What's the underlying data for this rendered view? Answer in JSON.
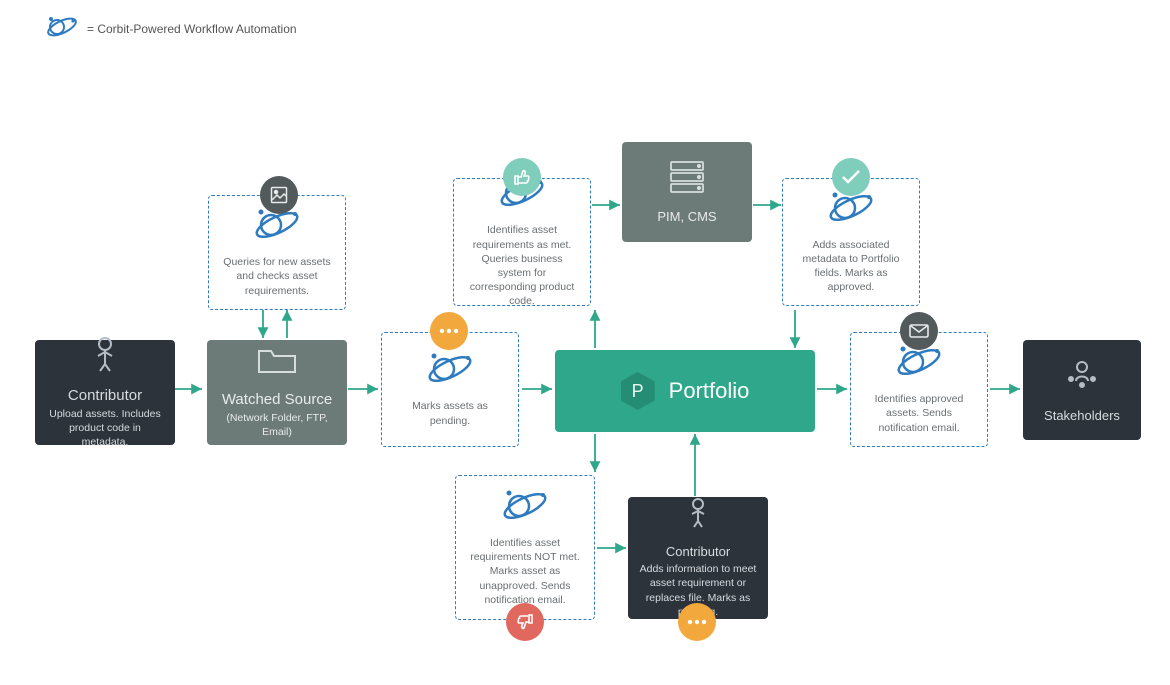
{
  "legend": {
    "text": "= Corbit-Powered Workflow Automation"
  },
  "nodes": {
    "contributor1": {
      "title": "Contributor",
      "sub": "Upload assets. Includes product code in metadata."
    },
    "watchedSource": {
      "title": "Watched Source",
      "sub": "(Network Folder, FTP, Email)"
    },
    "queryAssets": {
      "sub": "Queries for new assets and checks asset requirements."
    },
    "marksPending": {
      "sub": "Marks assets as pending."
    },
    "portfolio": {
      "label": "Portfolio",
      "badge": "P"
    },
    "reqMet": {
      "sub": "Identifies asset requirements as met. Queries business system for corresponding product code."
    },
    "pimCms": {
      "title": "PIM, CMS"
    },
    "addsMetadata": {
      "sub": "Adds associated metadata to Portfolio fields. Marks as approved."
    },
    "reqNotMet": {
      "sub": "Identifies asset requirements NOT met. Marks asset as unapproved. Sends notification email."
    },
    "contributor2": {
      "title": "Contributor",
      "sub": "Adds information to meet asset requirement or replaces file. Marks as pending."
    },
    "approvedAssets": {
      "sub": "Identifies approved assets. Sends notification email."
    },
    "stakeholders": {
      "title": "Stakeholders"
    }
  }
}
